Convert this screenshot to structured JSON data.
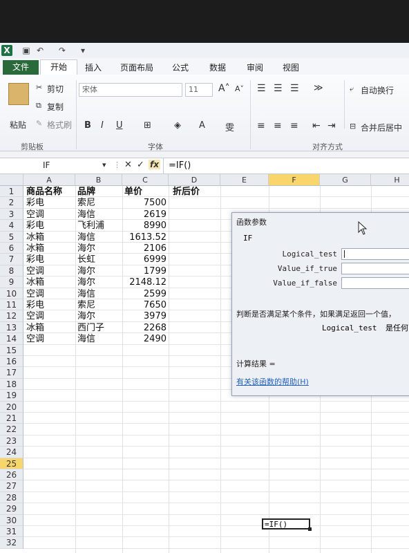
{
  "quick_access": {
    "excel_icon": "X",
    "undo_icon": "↶",
    "redo_icon": "↷"
  },
  "ribbon_tabs": [
    "文件",
    "开始",
    "插入",
    "页面布局",
    "公式",
    "数据",
    "审阅",
    "视图"
  ],
  "clipboard": {
    "paste": "粘贴",
    "cut": "剪切",
    "copy": "复制",
    "format_painter": "格式刷",
    "group_label": "剪贴板"
  },
  "font": {
    "name": "宋体",
    "size": "11",
    "bold": "B",
    "italic": "I",
    "underline": "U",
    "font_color": "A",
    "group_label": "字体"
  },
  "alignment": {
    "wrap": "自动换行",
    "merge": "合并后居中",
    "group_label": "对齐方式"
  },
  "formula_bar": {
    "name_box": "IF",
    "cancel": "✕",
    "enter": "✓",
    "fx": "fx",
    "formula": "=IF()"
  },
  "columns": [
    "A",
    "B",
    "C",
    "D",
    "E",
    "F",
    "G",
    "H"
  ],
  "rows": [
    "1",
    "2",
    "3",
    "4",
    "5",
    "6",
    "7",
    "8",
    "9",
    "10",
    "11",
    "12",
    "13",
    "14",
    "15",
    "16",
    "17",
    "18",
    "19",
    "20",
    "21",
    "22",
    "23",
    "24",
    "25",
    "26",
    "27",
    "28",
    "29",
    "30",
    "31",
    "32"
  ],
  "headers": {
    "a": "商品名称",
    "b": "品牌",
    "c": "单价",
    "d": "折后价"
  },
  "data_rows": [
    {
      "a": "彩电",
      "b": "索尼",
      "c": "7500"
    },
    {
      "a": "空调",
      "b": "海信",
      "c": "2619"
    },
    {
      "a": "彩电",
      "b": "飞利浦",
      "c": "8990"
    },
    {
      "a": "冰箱",
      "b": "海信",
      "c": "1613.52"
    },
    {
      "a": "冰箱",
      "b": "海尔",
      "c": "2106"
    },
    {
      "a": "彩电",
      "b": "长虹",
      "c": "6999"
    },
    {
      "a": "空调",
      "b": "海尔",
      "c": "1799"
    },
    {
      "a": "冰箱",
      "b": "海尔",
      "c": "2148.12"
    },
    {
      "a": "空调",
      "b": "海信",
      "c": "2599"
    },
    {
      "a": "彩电",
      "b": "索尼",
      "c": "7650"
    },
    {
      "a": "空调",
      "b": "海尔",
      "c": "3979"
    },
    {
      "a": "冰箱",
      "b": "西门子",
      "c": "2268"
    },
    {
      "a": "空调",
      "b": "海信",
      "c": "2490"
    }
  ],
  "editing_cell": "=IF()",
  "dialog": {
    "title": "函数参数",
    "function_name": "IF",
    "arg1": "Logical_test",
    "arg2": "Value_if_true",
    "arg3": "Value_if_false",
    "description": "判断是否满足某个条件，如果满足返回一个值，",
    "detail_name": "Logical_test",
    "detail_text": "是任何",
    "result_label": "计算结果 =",
    "help_link": "有关该函数的帮助(H)"
  },
  "colors": {
    "accent": "#2a6a3a",
    "active_col": "#f9d66b",
    "link": "#1f5fbf"
  }
}
